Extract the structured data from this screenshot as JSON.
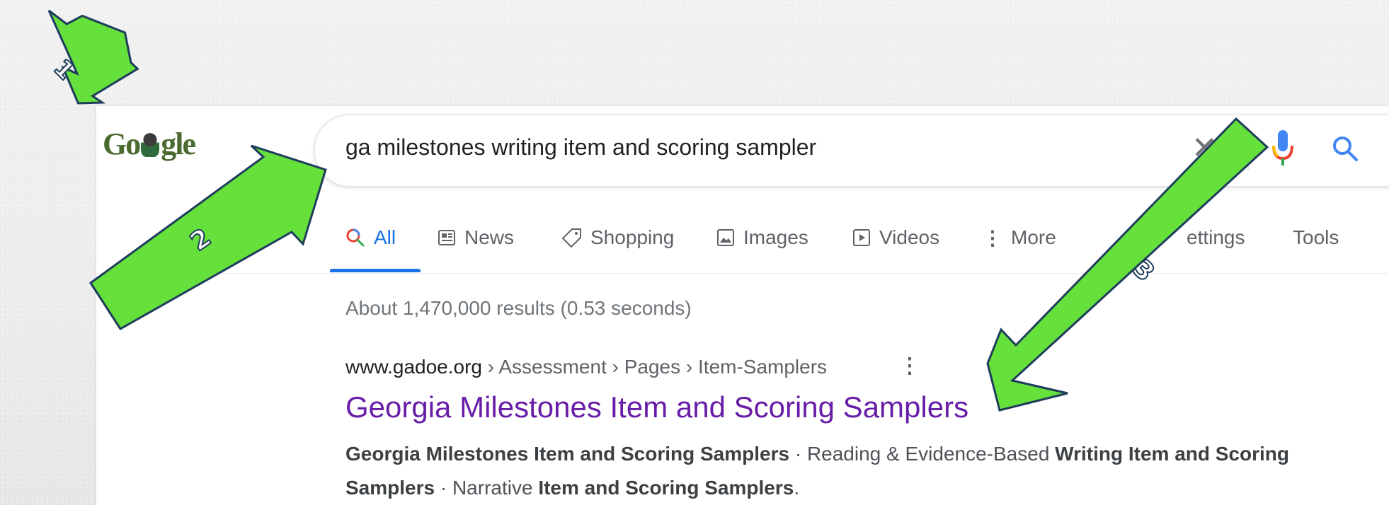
{
  "logo": {
    "text": "Google"
  },
  "search": {
    "query": "ga milestones writing item and scoring sampler"
  },
  "tabs": [
    {
      "label": "All",
      "icon": "search-icon",
      "active": true
    },
    {
      "label": "News",
      "icon": "news-icon"
    },
    {
      "label": "Shopping",
      "icon": "tag-icon"
    },
    {
      "label": "Images",
      "icon": "image-icon"
    },
    {
      "label": "Videos",
      "icon": "play-icon"
    },
    {
      "label": "More",
      "icon": "dots-vertical-icon"
    }
  ],
  "tools": {
    "settings": "ettings",
    "tools": "Tools"
  },
  "stats": "About 1,470,000 results (0.53 seconds)",
  "result": {
    "domain": "www.gadoe.org",
    "path": " › Assessment › Pages › Item-Samplers",
    "title": "Georgia Milestones Item and Scoring Samplers",
    "snippet": {
      "s1_b": "Georgia Milestones Item and Scoring Samplers",
      "s2": " · Reading & Evidence-Based ",
      "s3_b": "Writing Item and Scoring Samplers",
      "s4": " · Narrative ",
      "s5_b": "Item and Scoring Samplers",
      "s6": "."
    }
  },
  "annotations": [
    {
      "label": "1"
    },
    {
      "label": "2"
    },
    {
      "label": "3"
    }
  ],
  "colors": {
    "arrow_fill": "#66e03a",
    "arrow_stroke": "#1e3d5c",
    "accent": "#1a73e8",
    "visited_link": "#681da8"
  }
}
